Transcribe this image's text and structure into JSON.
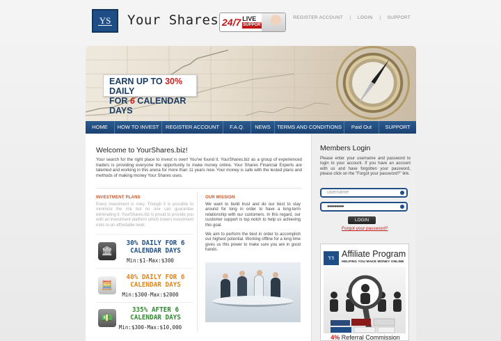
{
  "header": {
    "logo_text": "YS",
    "site_name": "Your Shares",
    "badge_247": "24/7",
    "badge_live": "LIVE",
    "badge_support": "SUPPORT",
    "links": [
      "REGISTER ACCOUNT",
      "LOGIN",
      "SUPPORT"
    ]
  },
  "banner": {
    "promo_line1_prefix": "EARN UP TO ",
    "promo_line1_highlight": "30%",
    "promo_line1_suffix": " DAILY",
    "promo_line2_prefix": "FOR ",
    "promo_line2_highlight": "6",
    "promo_line2_suffix": " CALENDAR DAYS"
  },
  "nav": {
    "items": [
      "HOME",
      "HOW TO INVEST",
      "REGISTER ACCOUNT",
      "F.A.Q.",
      "NEWS",
      "TERMS AND CONDITIONS",
      "Paid Out",
      "SUPPORT"
    ]
  },
  "main": {
    "welcome_title": "Welcome to YourShares.biz!",
    "welcome_text": "Your search for the right place to invest is over! You've found it. YourShares.biz as a group of experienced traders is providing everyone the opportunity to make money online. Your Shares Financial Experts are talented and working in this arena for more than 11 years now. Your money is safe with the tested plans and methods of making money Your Shares uses.",
    "investment_plans_heading": "INVESTMENT PLANS",
    "investment_text": "Every investment is risky. Though it is possible to minimize the risk but no one can guarantee eliminating it. YourShares.biz is proud to provide you with an investment platform which lowers investment risks to an affordable level.",
    "mission_heading": "OUR MISSION",
    "mission_p1": "We want to build trust and do our best to stay around for long in order to have a long-term relationship with our customers. In this regard, our customer support is top notch to help us achieving this goal.",
    "mission_p2": "We aim to perform the best in order to accomplish our highest potential. Working offline for a long time gives us this power to make sure you are in good hands.",
    "plans": [
      {
        "rate_line1": "30% DAILY FOR 6",
        "rate_line2": "CALENDAR DAYS",
        "minmax": "Min:$1-Max:$300",
        "color": "#1f4e86",
        "icon": "bank-icon"
      },
      {
        "rate_line1": "40% DAILY FOR 6",
        "rate_line2": "CALENDAR DAYS",
        "minmax": "Min:$300-Max:$2000",
        "color": "#e0861c",
        "icon": "calculator-icon"
      },
      {
        "rate_line1": "335% AFTER 6",
        "rate_line2": "CALENDAR DAYS",
        "minmax": "Min:$300-Max:$10,000",
        "color": "#2f8a2f",
        "icon": "money-icon"
      }
    ]
  },
  "sidebar": {
    "login_title": "Members Login",
    "login_text": "Please enter your username and password to login to your account. If you have an account with us and have forgotten your password, please click on the \"Forgot your password?\" link.",
    "username_placeholder": "username",
    "password_value": "●●●●●●●●●",
    "login_button": "LOGIN",
    "forgot_link": "Forgot your password?",
    "affiliate_logo": "YS",
    "affiliate_title": "Affiliate Program",
    "affiliate_subtitle": "HELPING YOU MAKE MONEY ONLINE",
    "affiliate_pct": "4%",
    "affiliate_commission": " Referral Commission"
  }
}
